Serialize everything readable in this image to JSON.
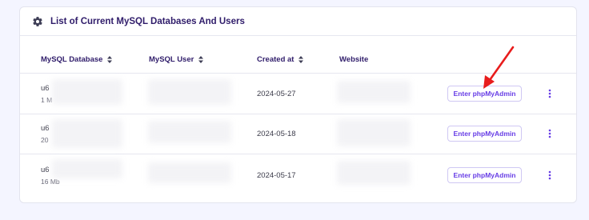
{
  "card": {
    "title": "List of Current MySQL Databases And Users",
    "icon": "gear-icon"
  },
  "table": {
    "headers": {
      "database": "MySQL Database",
      "user": "MySQL User",
      "created": "Created at",
      "website": "Website"
    },
    "rows": [
      {
        "db_name": "u6",
        "db_size": "1 M",
        "created_at": "2024-05-27",
        "action_label": "Enter phpMyAdmin"
      },
      {
        "db_name": "u6",
        "db_size": "20",
        "created_at": "2024-05-18",
        "action_label": "Enter phpMyAdmin"
      },
      {
        "db_name": "u6",
        "db_size": "16 Mb",
        "created_at": "2024-05-17",
        "action_label": "Enter phpMyAdmin"
      }
    ]
  },
  "colors": {
    "accent": "#673de6",
    "annotation_arrow": "#e81c1c",
    "title": "#2f1c6a",
    "background": "#f4f5ff"
  }
}
